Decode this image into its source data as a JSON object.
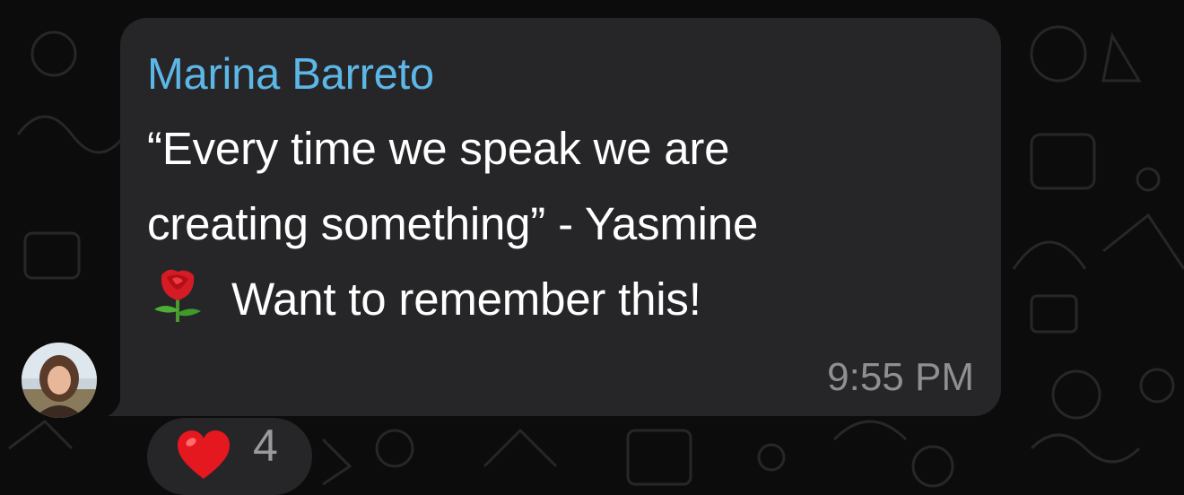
{
  "message": {
    "sender": "Marina Barreto",
    "lines": [
      "“Every time we speak we are",
      "creating something” - Yasmine",
      "Want to remember this!"
    ],
    "inline_emoji": "rose-icon",
    "time": "9:55 PM"
  },
  "reaction": {
    "emoji": "heart-icon",
    "count": "4"
  },
  "colors": {
    "bubble": "#262628",
    "sender_name": "#5cb6e6",
    "timestamp": "#8f8f93",
    "background": "#0c0c0d"
  }
}
